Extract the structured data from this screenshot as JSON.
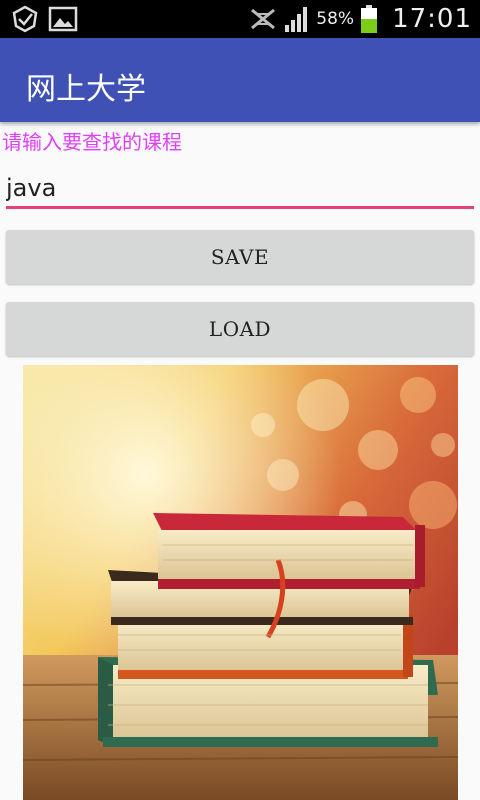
{
  "status_bar": {
    "battery_percent": "58%",
    "time": "17:01",
    "icons": [
      "app-notification-icon",
      "gallery-icon",
      "mute-icon",
      "signal-icon",
      "battery-icon"
    ]
  },
  "app_bar": {
    "title": "网上大学"
  },
  "search": {
    "prompt": "请输入要查找的课程",
    "value": "java"
  },
  "buttons": {
    "save_label": "SAVE",
    "load_label": "LOAD"
  },
  "image": {
    "subject": "books-photo"
  },
  "colors": {
    "app_bar": "#3f51b5",
    "accent": "#e5407a",
    "prompt_text": "#e040fb",
    "button_bg": "#d6d7d7",
    "battery": "#7ccc1a"
  }
}
